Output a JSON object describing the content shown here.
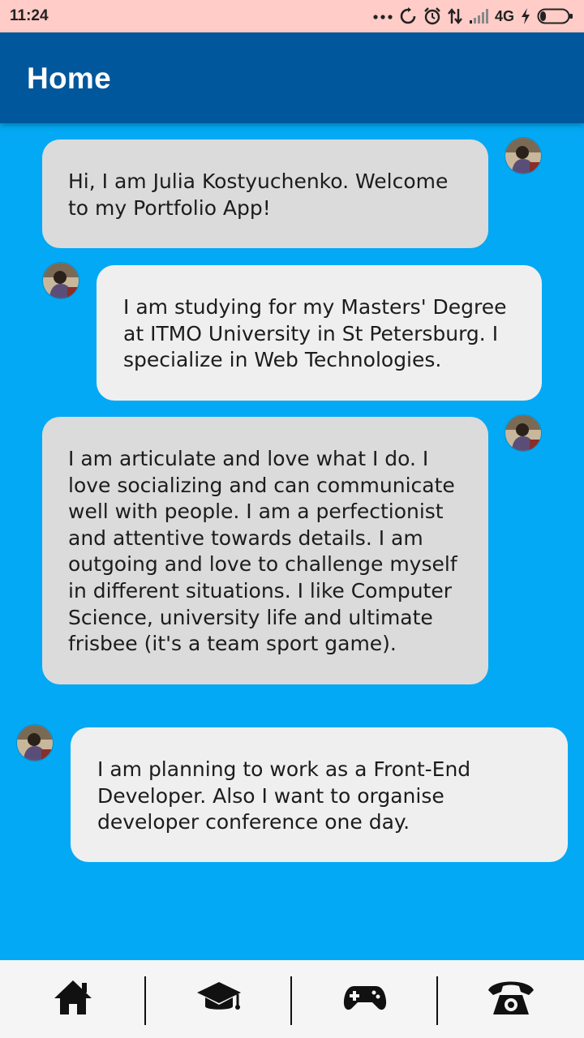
{
  "status_bar": {
    "time": "11:24",
    "network": "4G"
  },
  "app_bar": {
    "title": "Home"
  },
  "messages": [
    {
      "text": "Hi, I am Julia Kostyuchenko. Welcome to my Portfolio App!"
    },
    {
      "text": "I am studying for my Masters' Degree at ITMO University in St Petersburg. I specialize in Web Technologies."
    },
    {
      "text": "I am articulate and love what I do. I love socializing and can communicate well with people. I am a perfectionist and attentive towards details. I am outgoing and love to challenge myself in different situations. I like Computer Science, university life and ultimate frisbee (it's a team sport game)."
    },
    {
      "text": "I am planning to work as a Front-End Developer. Also I want to organise developer conference one day."
    }
  ],
  "bottom_nav": {
    "items": [
      {
        "icon": "home-icon"
      },
      {
        "icon": "graduation-cap-icon"
      },
      {
        "icon": "gamepad-icon"
      },
      {
        "icon": "telephone-icon"
      }
    ]
  },
  "colors": {
    "status_bar": "#FFCCC7",
    "app_bar": "#01579B",
    "background": "#03A9F4",
    "bubble_grey": "#DBDBDB",
    "bubble_light": "#EFEFEF"
  }
}
